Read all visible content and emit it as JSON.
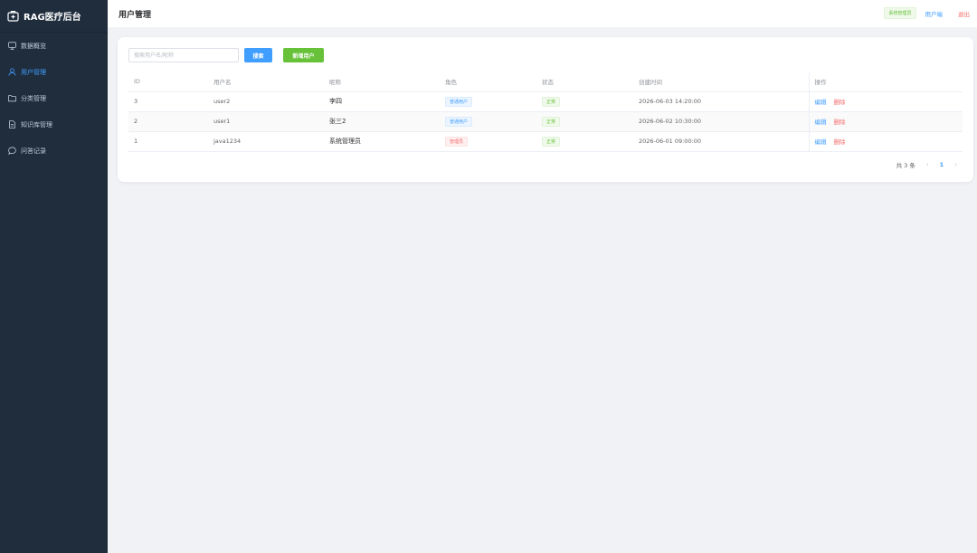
{
  "sidebar": {
    "brand": "RAG医疗后台",
    "items": [
      {
        "label": "数据概览",
        "icon": "chart-icon"
      },
      {
        "label": "用户管理",
        "icon": "user-icon",
        "active": true
      },
      {
        "label": "分类管理",
        "icon": "folder-icon"
      },
      {
        "label": "知识库管理",
        "icon": "document-icon"
      },
      {
        "label": "问答记录",
        "icon": "chat-icon"
      }
    ]
  },
  "header": {
    "title": "用户管理",
    "role_tag": "系统管理员",
    "user_side_link": "用户端",
    "logout": "退出"
  },
  "toolbar": {
    "search_placeholder": "搜索用户名/昵称",
    "search_label": "搜索",
    "add_label": "新增用户"
  },
  "table": {
    "columns": [
      "ID",
      "用户名",
      "昵称",
      "角色",
      "状态",
      "创建时间",
      "操作"
    ],
    "rows": [
      {
        "id": "3",
        "username": "user2",
        "nickname": "李四",
        "role": "普通用户",
        "status": "正常",
        "created": "2026-06-03 14:20:00",
        "edit": "编辑",
        "delete": "删除"
      },
      {
        "id": "2",
        "username": "user1",
        "nickname": "张三2",
        "role": "普通用户",
        "status": "正常",
        "created": "2026-06-02 10:30:00",
        "edit": "编辑",
        "delete": "删除"
      },
      {
        "id": "1",
        "username": "java1234",
        "nickname": "系统管理员",
        "role": "管理员",
        "status": "正常",
        "created": "2026-06-01 09:00:00",
        "edit": "编辑",
        "delete": "删除"
      }
    ]
  },
  "pagination": {
    "total": "共 3 条",
    "current_page": "1",
    "prev": "‹",
    "next": "›"
  },
  "colors": {
    "sidebar_bg": "#1f2d3d",
    "primary": "#409eff",
    "success": "#67c23a",
    "danger": "#f56c6c"
  }
}
